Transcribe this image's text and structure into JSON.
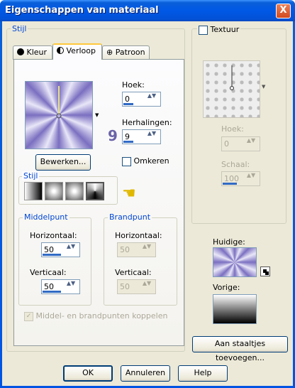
{
  "window": {
    "title": "Eigenschappen van materiaal",
    "close": "X"
  },
  "stijl_group": "Stijl",
  "tabs": [
    {
      "label": "Kleur"
    },
    {
      "label": "Verloop"
    },
    {
      "label": "Patroon"
    }
  ],
  "verloop": {
    "hoek_label": "Hoek:",
    "hoek_value": "0",
    "herhalingen_label": "Herhalingen:",
    "herhalingen_value": "9",
    "annotation_number": "9",
    "bewerken_label": "Bewerken...",
    "omkeren_label": "Omkeren",
    "stijl_label": "Stijl",
    "middelpunt": {
      "title": "Middelpunt",
      "h_label": "Horizontaal:",
      "h_value": "50",
      "v_label": "Verticaal:",
      "v_value": "50"
    },
    "brandpunt": {
      "title": "Brandpunt",
      "h_label": "Horizontaal:",
      "h_value": "50",
      "v_label": "Verticaal:",
      "v_value": "50"
    },
    "koppelen_label": "Middel- en brandpunten koppelen"
  },
  "textuur": {
    "label": "Textuur",
    "hoek_label": "Hoek:",
    "hoek_value": "0",
    "schaal_label": "Schaal:",
    "schaal_value": "100"
  },
  "huidige_label": "Huidige:",
  "vorige_label": "Vorige:",
  "staaltjes_button": "Aan staaltjes toevoegen...",
  "buttons": {
    "ok": "OK",
    "cancel": "Annuleren",
    "help": "Help"
  }
}
